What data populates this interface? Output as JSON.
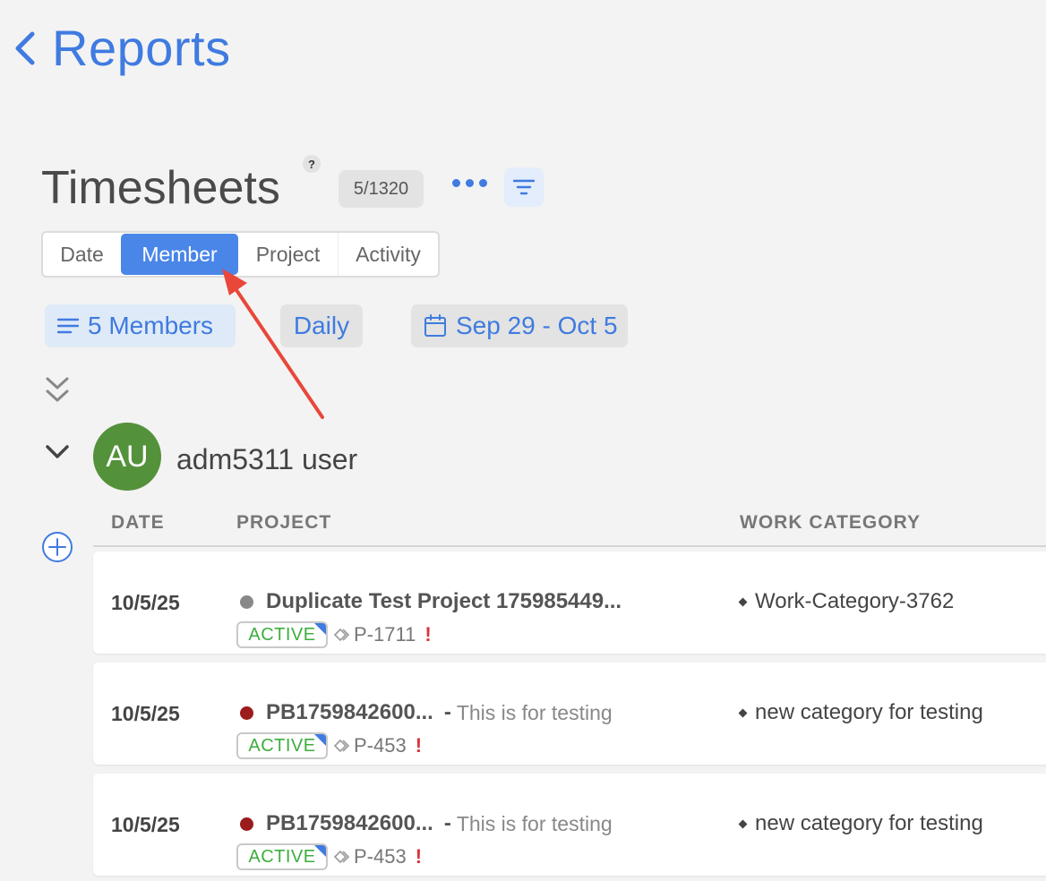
{
  "nav": {
    "back_label": "Reports"
  },
  "header": {
    "title": "Timesheets",
    "help": "?",
    "count": "5/1320"
  },
  "tabs": [
    {
      "label": "Date",
      "active": false
    },
    {
      "label": "Member",
      "active": true
    },
    {
      "label": "Project",
      "active": false
    },
    {
      "label": "Activity",
      "active": false
    }
  ],
  "filters": {
    "members": "5 Members",
    "frequency": "Daily",
    "date_range": "Sep 29 - Oct 5"
  },
  "group": {
    "initials": "AU",
    "name": "adm5311 user",
    "avatar_color": "#54913b"
  },
  "table": {
    "headers": {
      "date": "DATE",
      "project": "PROJECT",
      "work": "WORK CATEGORY"
    },
    "rows": [
      {
        "date": "10/5/25",
        "project": "Duplicate Test Project 175985449...",
        "separator": "",
        "description": "",
        "dot_color": "#888888",
        "status": "ACTIVE",
        "code": "P-1711",
        "flag": "!",
        "work_category": "Work-Category-3762"
      },
      {
        "date": "10/5/25",
        "project": "PB1759842600...",
        "separator": "-",
        "description": "This is for testing",
        "dot_color": "#9b1c1c",
        "status": "ACTIVE",
        "code": "P-453",
        "flag": "!",
        "work_category": "new category for testing"
      },
      {
        "date": "10/5/25",
        "project": "PB1759842600...",
        "separator": "-",
        "description": "This is for testing",
        "dot_color": "#9b1c1c",
        "status": "ACTIVE",
        "code": "P-453",
        "flag": "!",
        "work_category": "new category for testing"
      }
    ]
  },
  "colors": {
    "accent": "#3f7be0",
    "active_tab": "#4a86e8",
    "status_green": "#3dae3d",
    "annotation": "#e8473a"
  }
}
